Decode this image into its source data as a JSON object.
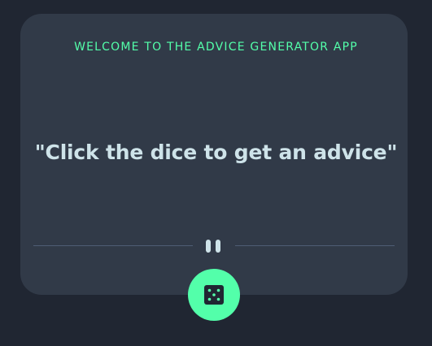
{
  "app": {
    "heading": "WELCOME TO THE ADVICE GENERATOR APP",
    "quote": "\"Click the dice to get an advice\""
  },
  "icons": {
    "divider": "pause-icon",
    "button": "dice-icon"
  },
  "colors": {
    "background": "#202632",
    "card": "#313a48",
    "accent": "#53ffaa",
    "text": "#cee3e9",
    "divider": "#4f5d74"
  }
}
